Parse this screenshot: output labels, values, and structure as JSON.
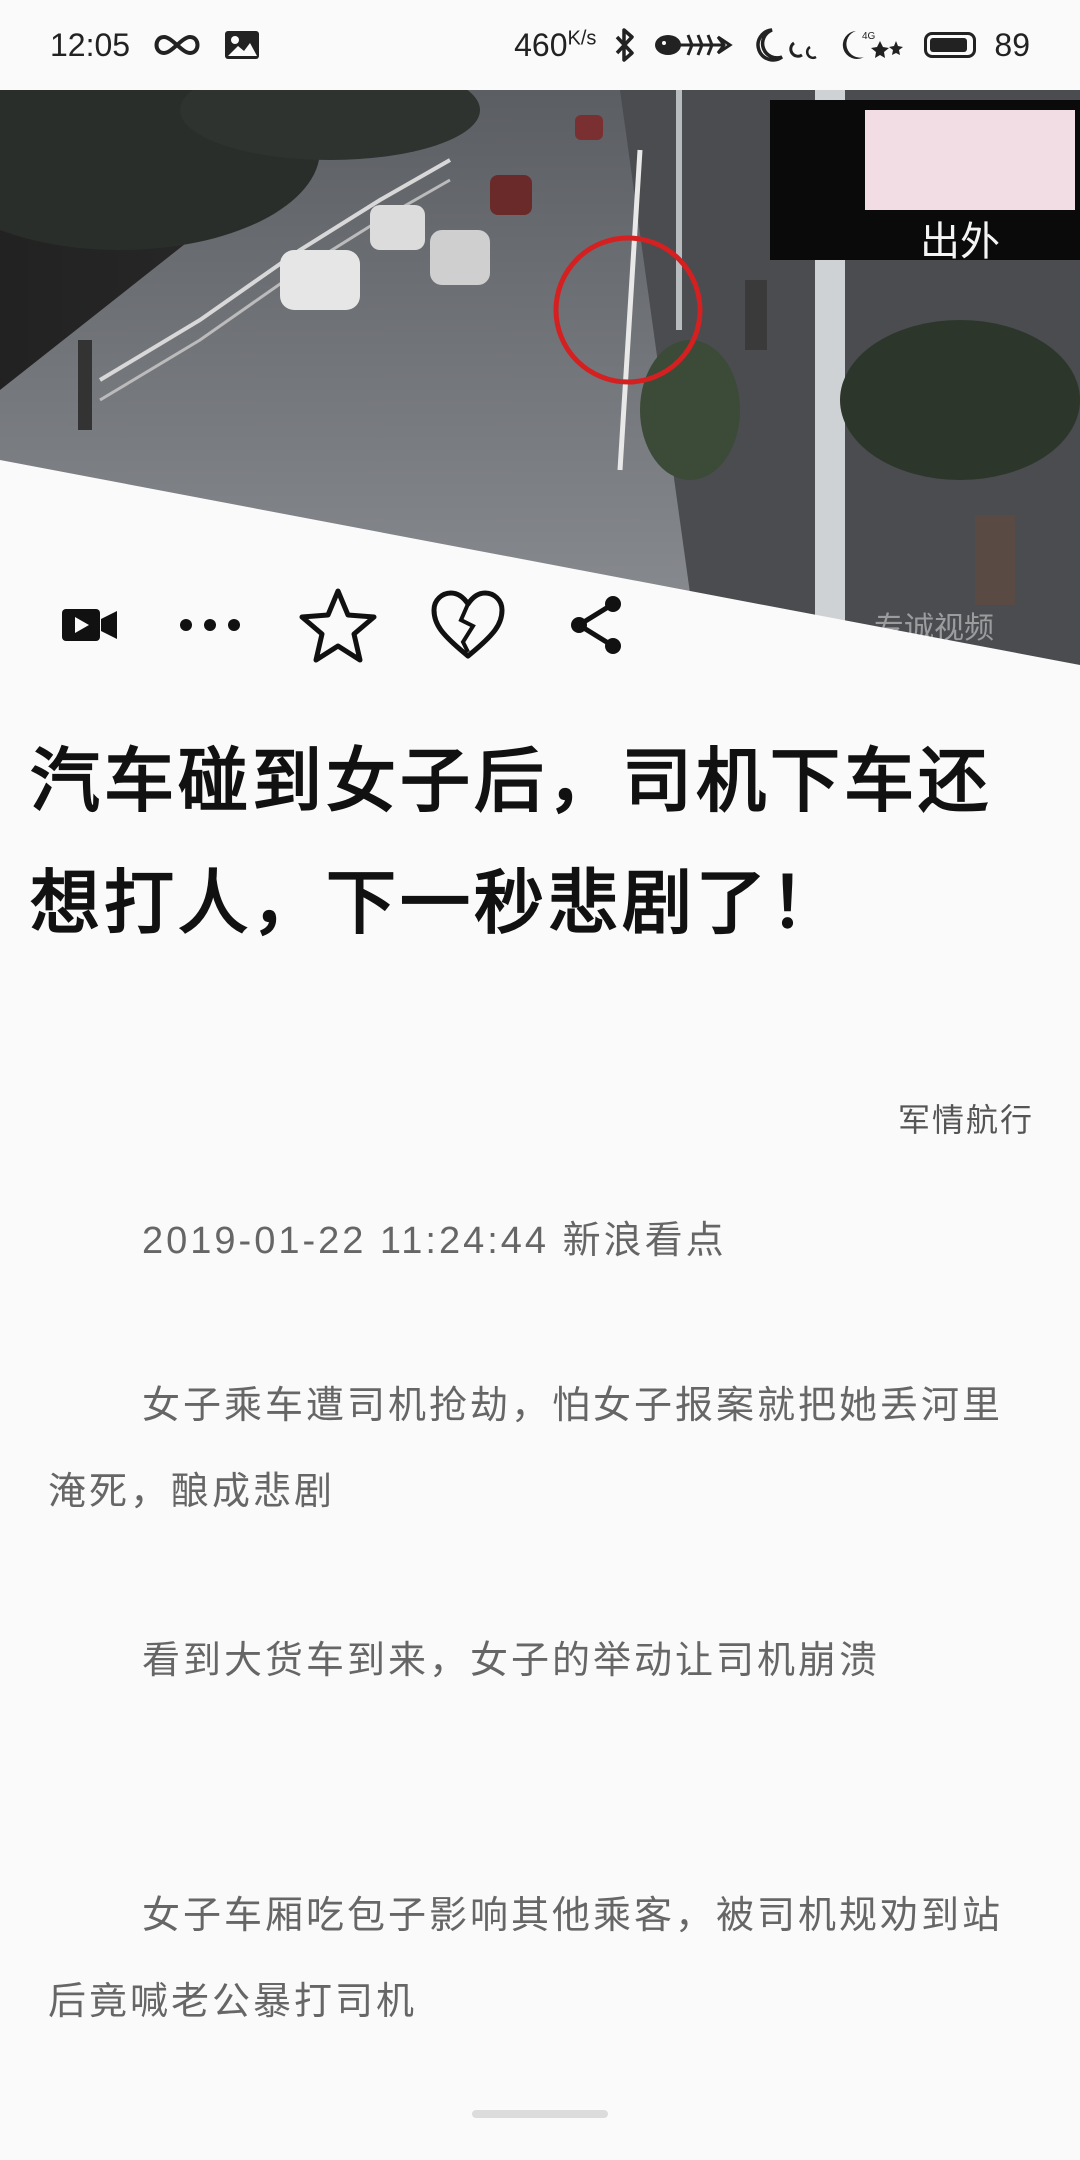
{
  "status_bar": {
    "time": "12:05",
    "net_speed": "460",
    "net_speed_unit": "K/s",
    "battery_level": "89",
    "icons": [
      "infinity-icon",
      "image-icon",
      "bluetooth-icon",
      "fish-bone-icon",
      "moon-icon",
      "signal-4g-icon",
      "battery-icon"
    ]
  },
  "hero": {
    "watermark": "专诚视频",
    "caption_overlay": "出外"
  },
  "toolbar": {
    "icons": [
      "video-icon",
      "more-icon",
      "star-icon",
      "broken-heart-icon",
      "share-icon"
    ]
  },
  "article": {
    "title": "汽车碰到女子后，司机下车还想打人，下一秒悲剧了！",
    "author": "军情航行",
    "date_line": "2019-01-22 11:24:44 新浪看点",
    "paragraphs": [
      "女子乘车遭司机抢劫，怕女子报案就把她丢河里淹死，酿成悲剧",
      "看到大货车到来，女子的举动让司机崩溃",
      "女子车厢吃包子影响其他乘客，被司机规劝到站后竟喊老公暴打司机"
    ]
  },
  "colors": {
    "background": "#fafafa",
    "title": "#111111",
    "body_text": "#666666",
    "highlight_circle": "#d42020"
  }
}
